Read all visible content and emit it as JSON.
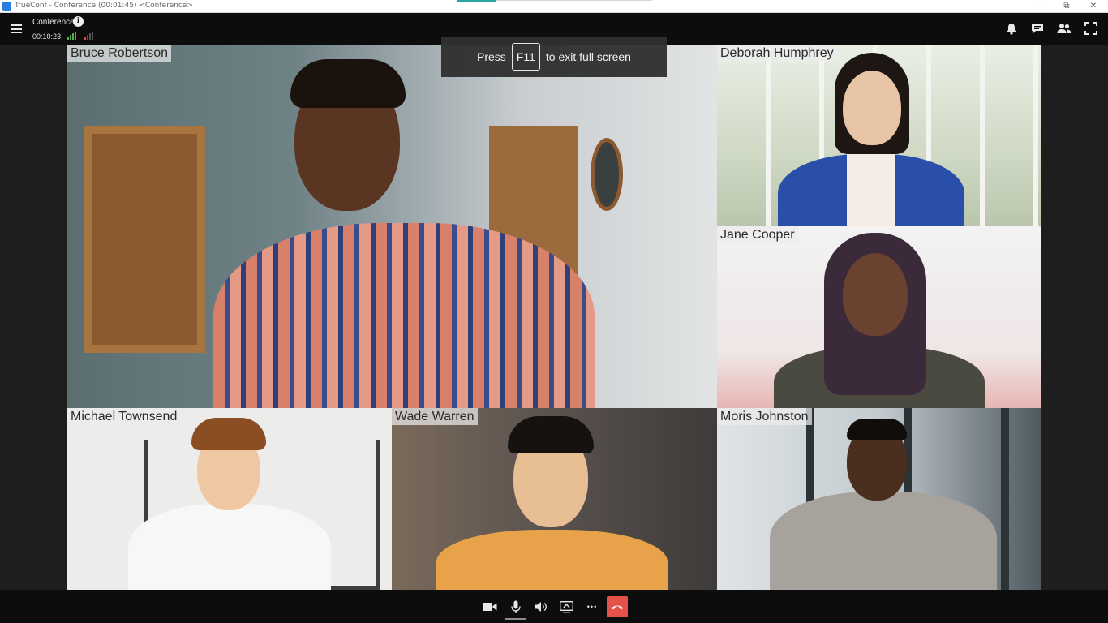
{
  "window": {
    "title": "TrueConf - Conference (00:01:45) <Conference>",
    "controls": {
      "minimize": "–",
      "restore": "⧉",
      "close": "✕"
    }
  },
  "toolbar": {
    "conference_title": "Conference",
    "info_glyph": "i",
    "elapsed": "00:10:23",
    "icons": [
      "menu-icon",
      "info-icon",
      "signal-good-icon",
      "signal-low-icon",
      "bell-icon",
      "chat-icon",
      "participants-icon",
      "fullscreen-exit-icon"
    ]
  },
  "toast": {
    "prefix": "Press",
    "key": "F11",
    "suffix": "to exit full screen"
  },
  "participants": [
    {
      "name": "Bruce Robertson"
    },
    {
      "name": "Deborah Humphrey"
    },
    {
      "name": "Jane Cooper"
    },
    {
      "name": "Michael Townsend"
    },
    {
      "name": "Wade Warren"
    },
    {
      "name": "Moris Johnston"
    }
  ],
  "controls_bar": {
    "icons": [
      "camera-icon",
      "microphone-icon",
      "speaker-icon",
      "share-screen-icon",
      "more-icon",
      "hang-up-icon"
    ],
    "more_glyph": "•••"
  },
  "colors": {
    "accent": "#2aa6a0",
    "hangup": "#e5524a",
    "signal_good": "#4fb046",
    "signal_low": "#d94a3c",
    "toolbar_bg": "#0d0d0d"
  }
}
